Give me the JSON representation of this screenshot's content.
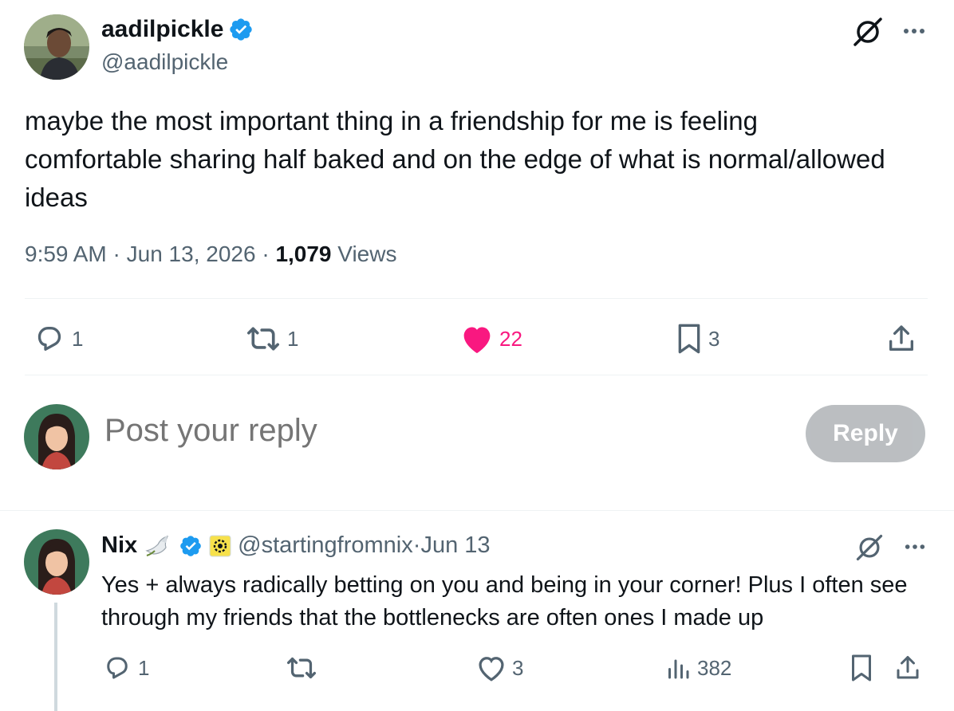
{
  "tweet": {
    "author_name": "aadilpickle",
    "author_handle": "@aadilpickle",
    "text": "maybe the most important thing in a friendship for me is feeling comfortable sharing half baked and on the edge of what is normal/allowed ideas",
    "time": "9:59 AM",
    "sep1": " · ",
    "date": "Jun 13, 2026",
    "sep2": " · ",
    "views_count": "1,079",
    "views_label": " Views",
    "actions": {
      "replies": "1",
      "reposts": "1",
      "likes": "22",
      "bookmarks": "3"
    },
    "icons": [
      "verified-badge-icon",
      "grok-icon",
      "more-icon",
      "reply-icon",
      "repost-icon",
      "heart-icon",
      "bookmark-icon",
      "share-icon"
    ]
  },
  "composer": {
    "placeholder": "Post your reply",
    "reply_label": "Reply"
  },
  "reply": {
    "author_name": "Nix",
    "author_handle": "@startingfromnix",
    "sep": " · ",
    "date": "Jun 13",
    "text": "Yes + always radically betting on you and being in your corner! Plus I often see through my friends that the bottlenecks are often ones I made up",
    "actions": {
      "replies": "1",
      "likes": "3",
      "views": "382"
    },
    "icons": [
      "dove-emoji-icon",
      "verified-badge-icon",
      "affiliate-badge-icon",
      "grok-icon",
      "more-icon",
      "reply-icon",
      "repost-icon",
      "heart-outline-icon",
      "analytics-icon",
      "bookmark-icon",
      "share-icon"
    ]
  },
  "colors": {
    "text": "#0f1419",
    "secondary": "#536471",
    "verified": "#1d9bf0",
    "like": "#f91880",
    "divider": "#eff3f4"
  }
}
